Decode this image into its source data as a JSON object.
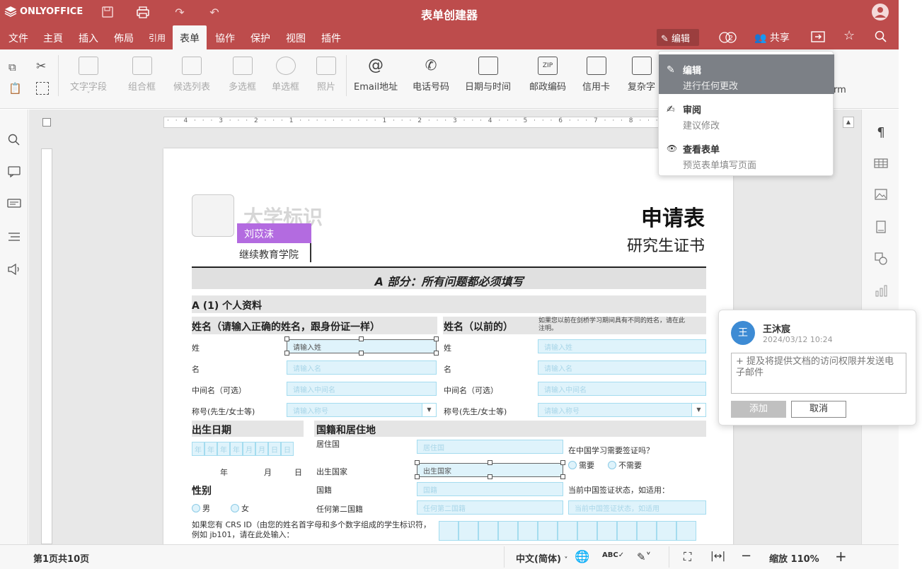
{
  "titlebar": {
    "brand": "ONLYOFFICE",
    "title": "表单创建器"
  },
  "menubar": {
    "items": [
      "文件",
      "主頁",
      "插入",
      "佈局",
      "引用",
      "表单",
      "協作",
      "保护",
      "视图",
      "插件"
    ],
    "active": "表单",
    "edit_label": "编辑",
    "user_count": "2",
    "share_label": "共享"
  },
  "toolbar": {
    "tools": [
      {
        "label": "文字字段",
        "enabled": false
      },
      {
        "label": "组合框",
        "enabled": false
      },
      {
        "label": "候选列表",
        "enabled": false
      },
      {
        "label": "多选框",
        "enabled": false
      },
      {
        "label": "单选框",
        "enabled": false
      },
      {
        "label": "照片",
        "enabled": false
      },
      {
        "label": "Email地址",
        "enabled": true
      },
      {
        "label": "电话号码",
        "enabled": true
      },
      {
        "label": "日期与时间",
        "enabled": true
      },
      {
        "label": "邮政编码",
        "enabled": true
      },
      {
        "label": "信用卡",
        "enabled": true
      },
      {
        "label": "复杂字",
        "enabled": true
      }
    ],
    "partial_label": "rm"
  },
  "mode_menu": {
    "items": [
      {
        "title": "编辑",
        "subtitle": "进行任何更改",
        "selected": true
      },
      {
        "title": "审阅",
        "subtitle": "建议修改",
        "selected": false
      },
      {
        "title": "查看表单",
        "subtitle": "预览表单填写页面",
        "selected": false
      }
    ]
  },
  "comment": {
    "avatar_letter": "王",
    "author": "王沐宸",
    "date": "2024/03/12  10:24",
    "placeholder": "+ 提及将提供文档的访问权限并发送电子邮件",
    "add_label": "添加",
    "cancel_label": "取消"
  },
  "ruler": {
    "marks": "· · 4 · · · 3 · · · 2 · · · 1 · · · · · · ·   · · · 1 · · · 2 · · · 3 · · · 4 · · · 5 · · · 6 · · · 7 · · · 8 · · · 9 · · 10 · · 11 · · 12 · · 13 · · 1"
  },
  "document": {
    "logo_text": "大学标识",
    "author_tag": "刘苡沫",
    "college": "继续教育学院",
    "form_title": "申请表",
    "form_subtitle": "研究生证书",
    "section_a": "A 部分：所有问题都必须填写",
    "subsection_a1": "A (1) 个人资料",
    "name_header": "姓名（请输入正确的姓名，跟身份证一样）",
    "former_name_header": "姓名（以前的）",
    "former_name_note": "如果您以前在剑桥学习期间具有不同的姓名，请在此注明。",
    "rows": [
      {
        "label": "姓",
        "placeholder": "请输入姓",
        "label2": "姓",
        "placeholder2": "请输入姓"
      },
      {
        "label": "名",
        "placeholder": "请输入名",
        "label2": "名",
        "placeholder2": "请输入名"
      },
      {
        "label": "中间名（可选）",
        "placeholder": "请输入中间名",
        "label2": "中间名（可选）",
        "placeholder2": "请输入中间名"
      },
      {
        "label": "称号(先生/女士等)",
        "placeholder": "请输入称号",
        "label2": "称号(先生/女士等)",
        "placeholder2": "请输入称号"
      }
    ],
    "dob_header": "出生日期",
    "dob_cells": [
      "年",
      "年",
      "年",
      "年",
      "月",
      "月",
      "日",
      "日"
    ],
    "dob_labels": [
      "年",
      "月",
      "日"
    ],
    "nationality_header": "国籍和居住地",
    "residence_label": "居住国",
    "residence_placeholder": "居住国",
    "birth_country_label": "出生国家",
    "birth_country_value": "出生国家",
    "nationality_label": "国籍",
    "nationality_placeholder": "国籍",
    "second_nationality_label": "任何第二国籍",
    "second_nationality_placeholder": "任何第二国籍",
    "visa_question": "在中国学习需要签证吗？",
    "visa_yes": "需要",
    "visa_no": "不需要",
    "visa_status_label": "当前中国签证状态，如适用：",
    "visa_status_placeholder": "当前中国签证状态，如适用",
    "gender_header": "性别",
    "gender_male": "男",
    "gender_female": "女",
    "crs_text": "如果您有 CRS ID（由您的姓名首字母和多个数字组成的学生标识符，例如 jb101，请在此处输入："
  },
  "statusbar": {
    "page_info": "第1页共10页",
    "language": "中文(简体)",
    "zoom": "缩放 110%"
  },
  "colors": {
    "brand": "#bd4c4c",
    "field_bg": "#dff3fb",
    "field_border": "#a4dcef",
    "author_tag": "#b36be0",
    "comment_avatar": "#3d8bd4"
  }
}
